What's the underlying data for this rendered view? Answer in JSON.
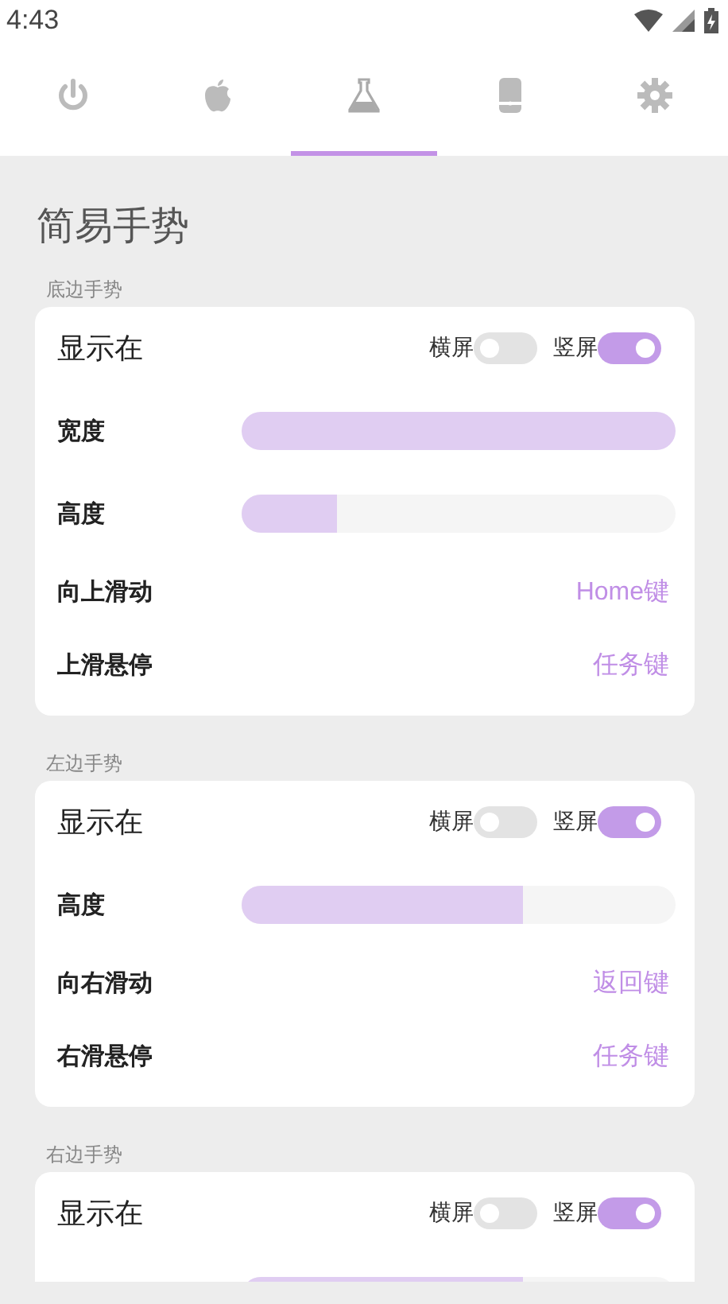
{
  "status_bar": {
    "time": "4:43"
  },
  "tabs": [
    {
      "kind": "power",
      "selected": false
    },
    {
      "kind": "apple",
      "selected": false
    },
    {
      "kind": "flask",
      "selected": true
    },
    {
      "kind": "phone",
      "selected": false
    },
    {
      "kind": "gear",
      "selected": false
    }
  ],
  "title": "简易手势",
  "sections": [
    {
      "label": "底边手势",
      "rows": [
        {
          "kind": "toggles",
          "label": "显示在",
          "toggles": [
            {
              "label": "横屏",
              "on": false
            },
            {
              "label": "竖屏",
              "on": true
            }
          ]
        },
        {
          "kind": "slider",
          "label": "宽度",
          "level": 1.0
        },
        {
          "kind": "slider",
          "label": "高度",
          "level": 0.22
        },
        {
          "kind": "action",
          "label": "向上滑动",
          "value": "Home键"
        },
        {
          "kind": "action",
          "label": "上滑悬停",
          "value": "任务键"
        }
      ]
    },
    {
      "label": "左边手势",
      "rows": [
        {
          "kind": "toggles",
          "label": "显示在",
          "toggles": [
            {
              "label": "横屏",
              "on": false
            },
            {
              "label": "竖屏",
              "on": true
            }
          ]
        },
        {
          "kind": "slider",
          "label": "高度",
          "level": 0.65
        },
        {
          "kind": "action",
          "label": "向右滑动",
          "value": "返回键"
        },
        {
          "kind": "action",
          "label": "右滑悬停",
          "value": "任务键"
        }
      ]
    },
    {
      "label": "右边手势",
      "rows": [
        {
          "kind": "toggles",
          "label": "显示在",
          "toggles": [
            {
              "label": "横屏",
              "on": false
            },
            {
              "label": "竖屏",
              "on": true
            }
          ]
        },
        {
          "kind": "slider",
          "level": 0.65
        }
      ]
    }
  ]
}
